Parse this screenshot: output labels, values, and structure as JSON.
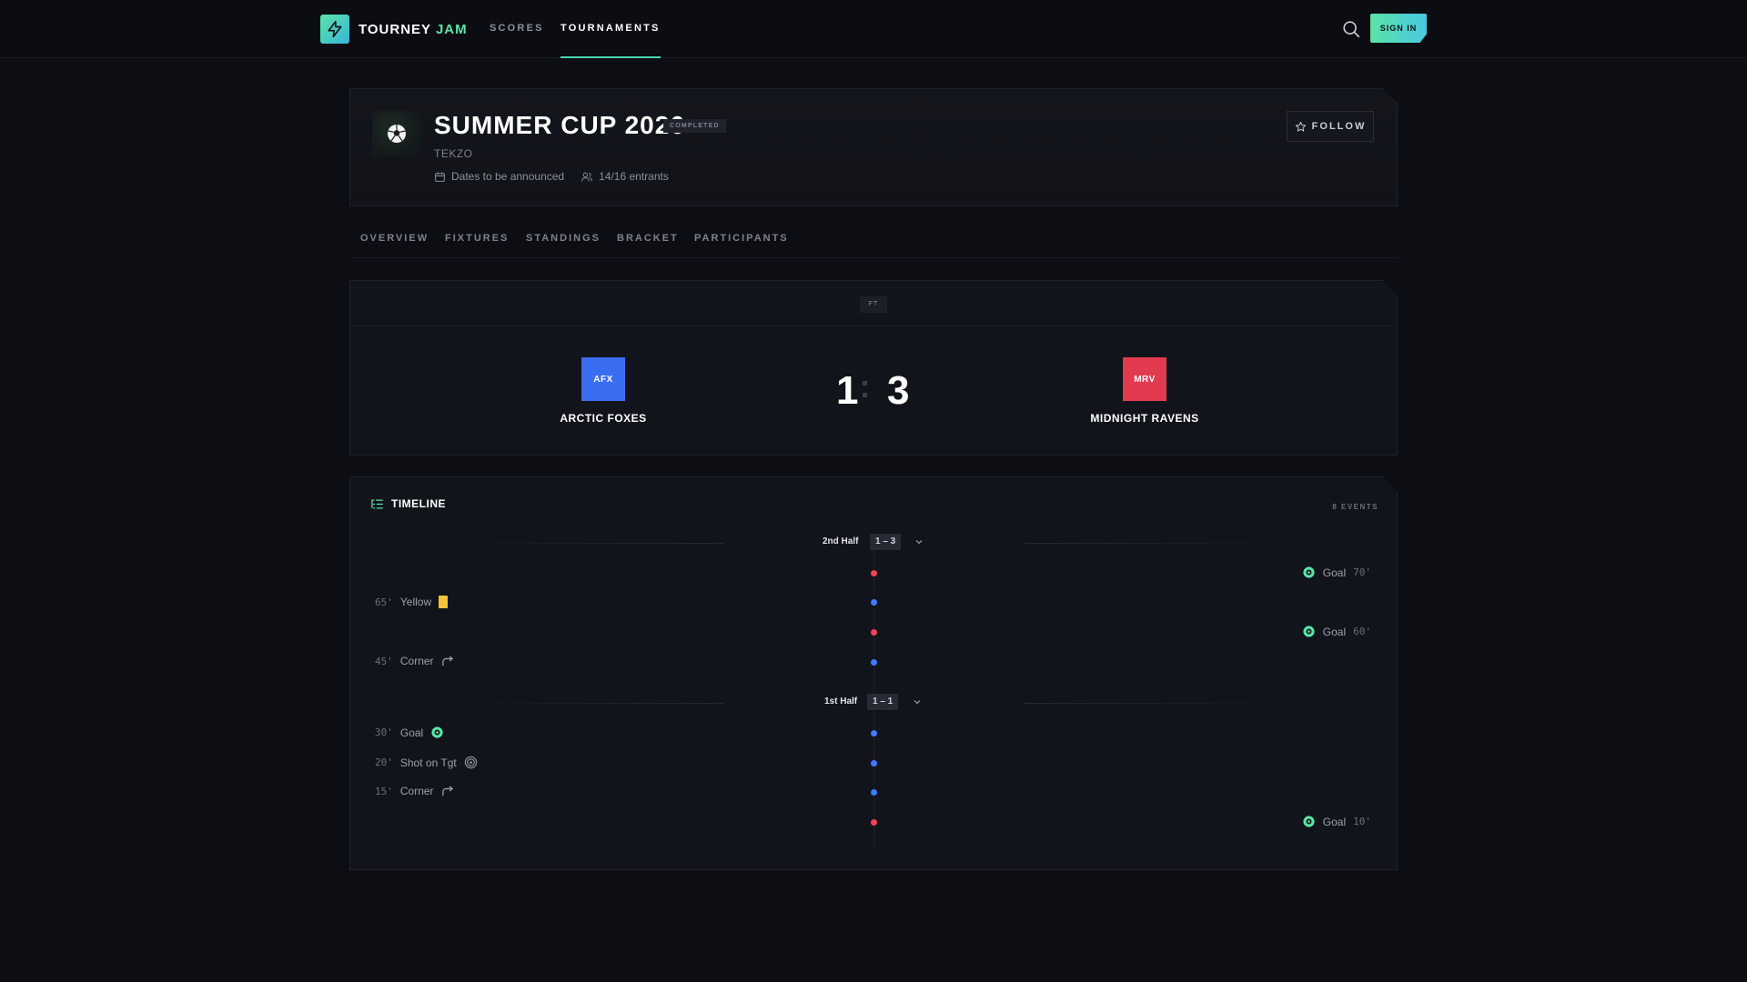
{
  "nav": {
    "logo_word1": "TOURNEY",
    "logo_word2": "JAM",
    "links": [
      "SCORES",
      "TOURNAMENTS"
    ],
    "active_link": "TOURNAMENTS",
    "signin": "SIGN IN"
  },
  "tournament": {
    "title": "SUMMER CUP 2026",
    "status": "COMPLETED",
    "organizer": "TEKZO",
    "dates": "Dates to be announced",
    "entrants": "14/16 entrants",
    "follow": "FOLLOW",
    "icon": "soccer-ball-icon"
  },
  "tabs": [
    "OVERVIEW",
    "FIXTURES",
    "STANDINGS",
    "BRACKET",
    "PARTICIPANTS"
  ],
  "match": {
    "status": "FT",
    "home": {
      "abbr": "AFX",
      "name": "ARCTIC FOXES",
      "color": "#3a6df0",
      "score": "1"
    },
    "away": {
      "abbr": "MRV",
      "name": "MIDNIGHT RAVENS",
      "color": "#e23a4f",
      "score": "3"
    }
  },
  "timeline": {
    "title": "TIMELINE",
    "count": "8 EVENTS",
    "second_half": {
      "label": "2nd Half",
      "score": "1 – 3"
    },
    "first_half": {
      "label": "1st Half",
      "score": "1 – 1"
    },
    "events": [
      {
        "side": "away",
        "label": "Goal",
        "minute": "70'",
        "icon": "goal-icon"
      },
      {
        "side": "home",
        "label": "Yellow",
        "minute": "65'",
        "icon": "yellow-card-icon"
      },
      {
        "side": "away",
        "label": "Goal",
        "minute": "60'",
        "icon": "goal-icon"
      },
      {
        "side": "home",
        "label": "Corner",
        "minute": "45'",
        "icon": "corner-icon"
      },
      {
        "side": "home",
        "label": "Goal",
        "minute": "30'",
        "icon": "goal-icon"
      },
      {
        "side": "home",
        "label": "Shot on Tgt",
        "minute": "20'",
        "icon": "target-icon"
      },
      {
        "side": "home",
        "label": "Corner",
        "minute": "15'",
        "icon": "corner-icon"
      },
      {
        "side": "away",
        "label": "Goal",
        "minute": "10'",
        "icon": "goal-icon"
      }
    ]
  },
  "colors": {
    "accent": "#5be3a7",
    "home_dot": "#3e7bff",
    "away_dot": "#f0435a",
    "yellow": "#f4c437"
  }
}
